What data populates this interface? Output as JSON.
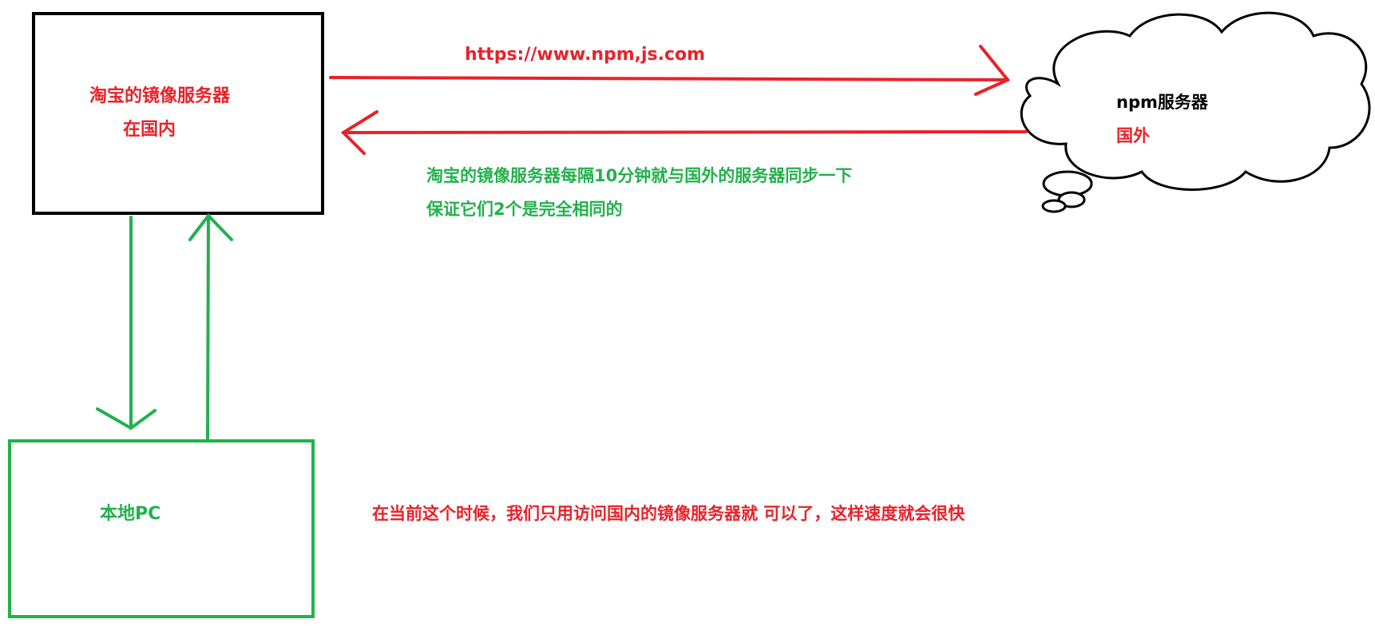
{
  "mirror_box": {
    "title": "淘宝的镜像服务器",
    "subtitle": "在国内"
  },
  "npm_cloud": {
    "title": "npm服务器",
    "subtitle": "国外"
  },
  "request_url": "https://www.npm,js.com",
  "sync_note": {
    "line1": "淘宝的镜像服务器每隔10分钟就与国外的服务器同步一下",
    "line2": "保证它们2个是完全相同的"
  },
  "local_pc": {
    "title": "本地PC"
  },
  "conclusion": "在当前这个时候，我们只用访问国内的镜像服务器就 可以了，这样速度就会很快",
  "colors": {
    "red": "#e8222a",
    "green": "#22b14c",
    "black": "#000000"
  }
}
